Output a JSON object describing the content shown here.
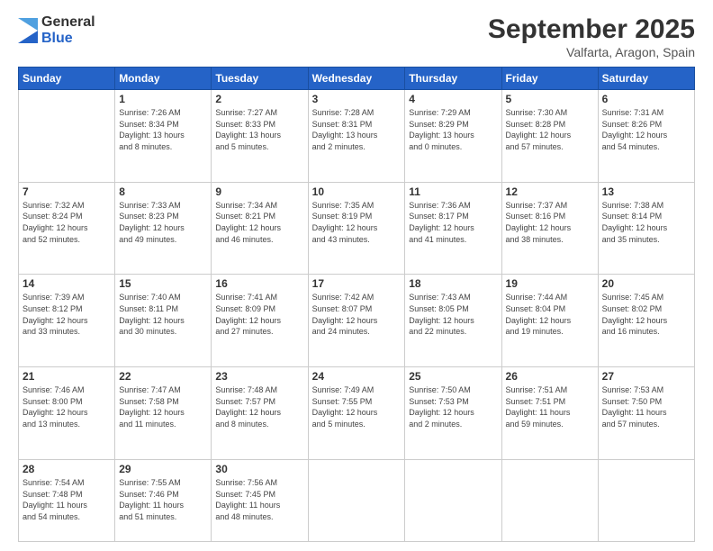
{
  "header": {
    "logo": {
      "general": "General",
      "blue": "Blue"
    },
    "title": "September 2025",
    "location": "Valfarta, Aragon, Spain"
  },
  "calendar": {
    "days_of_week": [
      "Sunday",
      "Monday",
      "Tuesday",
      "Wednesday",
      "Thursday",
      "Friday",
      "Saturday"
    ],
    "weeks": [
      [
        {
          "day": "",
          "info": ""
        },
        {
          "day": "1",
          "info": "Sunrise: 7:26 AM\nSunset: 8:34 PM\nDaylight: 13 hours\nand 8 minutes."
        },
        {
          "day": "2",
          "info": "Sunrise: 7:27 AM\nSunset: 8:33 PM\nDaylight: 13 hours\nand 5 minutes."
        },
        {
          "day": "3",
          "info": "Sunrise: 7:28 AM\nSunset: 8:31 PM\nDaylight: 13 hours\nand 2 minutes."
        },
        {
          "day": "4",
          "info": "Sunrise: 7:29 AM\nSunset: 8:29 PM\nDaylight: 13 hours\nand 0 minutes."
        },
        {
          "day": "5",
          "info": "Sunrise: 7:30 AM\nSunset: 8:28 PM\nDaylight: 12 hours\nand 57 minutes."
        },
        {
          "day": "6",
          "info": "Sunrise: 7:31 AM\nSunset: 8:26 PM\nDaylight: 12 hours\nand 54 minutes."
        }
      ],
      [
        {
          "day": "7",
          "info": "Sunrise: 7:32 AM\nSunset: 8:24 PM\nDaylight: 12 hours\nand 52 minutes."
        },
        {
          "day": "8",
          "info": "Sunrise: 7:33 AM\nSunset: 8:23 PM\nDaylight: 12 hours\nand 49 minutes."
        },
        {
          "day": "9",
          "info": "Sunrise: 7:34 AM\nSunset: 8:21 PM\nDaylight: 12 hours\nand 46 minutes."
        },
        {
          "day": "10",
          "info": "Sunrise: 7:35 AM\nSunset: 8:19 PM\nDaylight: 12 hours\nand 43 minutes."
        },
        {
          "day": "11",
          "info": "Sunrise: 7:36 AM\nSunset: 8:17 PM\nDaylight: 12 hours\nand 41 minutes."
        },
        {
          "day": "12",
          "info": "Sunrise: 7:37 AM\nSunset: 8:16 PM\nDaylight: 12 hours\nand 38 minutes."
        },
        {
          "day": "13",
          "info": "Sunrise: 7:38 AM\nSunset: 8:14 PM\nDaylight: 12 hours\nand 35 minutes."
        }
      ],
      [
        {
          "day": "14",
          "info": "Sunrise: 7:39 AM\nSunset: 8:12 PM\nDaylight: 12 hours\nand 33 minutes."
        },
        {
          "day": "15",
          "info": "Sunrise: 7:40 AM\nSunset: 8:11 PM\nDaylight: 12 hours\nand 30 minutes."
        },
        {
          "day": "16",
          "info": "Sunrise: 7:41 AM\nSunset: 8:09 PM\nDaylight: 12 hours\nand 27 minutes."
        },
        {
          "day": "17",
          "info": "Sunrise: 7:42 AM\nSunset: 8:07 PM\nDaylight: 12 hours\nand 24 minutes."
        },
        {
          "day": "18",
          "info": "Sunrise: 7:43 AM\nSunset: 8:05 PM\nDaylight: 12 hours\nand 22 minutes."
        },
        {
          "day": "19",
          "info": "Sunrise: 7:44 AM\nSunset: 8:04 PM\nDaylight: 12 hours\nand 19 minutes."
        },
        {
          "day": "20",
          "info": "Sunrise: 7:45 AM\nSunset: 8:02 PM\nDaylight: 12 hours\nand 16 minutes."
        }
      ],
      [
        {
          "day": "21",
          "info": "Sunrise: 7:46 AM\nSunset: 8:00 PM\nDaylight: 12 hours\nand 13 minutes."
        },
        {
          "day": "22",
          "info": "Sunrise: 7:47 AM\nSunset: 7:58 PM\nDaylight: 12 hours\nand 11 minutes."
        },
        {
          "day": "23",
          "info": "Sunrise: 7:48 AM\nSunset: 7:57 PM\nDaylight: 12 hours\nand 8 minutes."
        },
        {
          "day": "24",
          "info": "Sunrise: 7:49 AM\nSunset: 7:55 PM\nDaylight: 12 hours\nand 5 minutes."
        },
        {
          "day": "25",
          "info": "Sunrise: 7:50 AM\nSunset: 7:53 PM\nDaylight: 12 hours\nand 2 minutes."
        },
        {
          "day": "26",
          "info": "Sunrise: 7:51 AM\nSunset: 7:51 PM\nDaylight: 11 hours\nand 59 minutes."
        },
        {
          "day": "27",
          "info": "Sunrise: 7:53 AM\nSunset: 7:50 PM\nDaylight: 11 hours\nand 57 minutes."
        }
      ],
      [
        {
          "day": "28",
          "info": "Sunrise: 7:54 AM\nSunset: 7:48 PM\nDaylight: 11 hours\nand 54 minutes."
        },
        {
          "day": "29",
          "info": "Sunrise: 7:55 AM\nSunset: 7:46 PM\nDaylight: 11 hours\nand 51 minutes."
        },
        {
          "day": "30",
          "info": "Sunrise: 7:56 AM\nSunset: 7:45 PM\nDaylight: 11 hours\nand 48 minutes."
        },
        {
          "day": "",
          "info": ""
        },
        {
          "day": "",
          "info": ""
        },
        {
          "day": "",
          "info": ""
        },
        {
          "day": "",
          "info": ""
        }
      ]
    ]
  }
}
